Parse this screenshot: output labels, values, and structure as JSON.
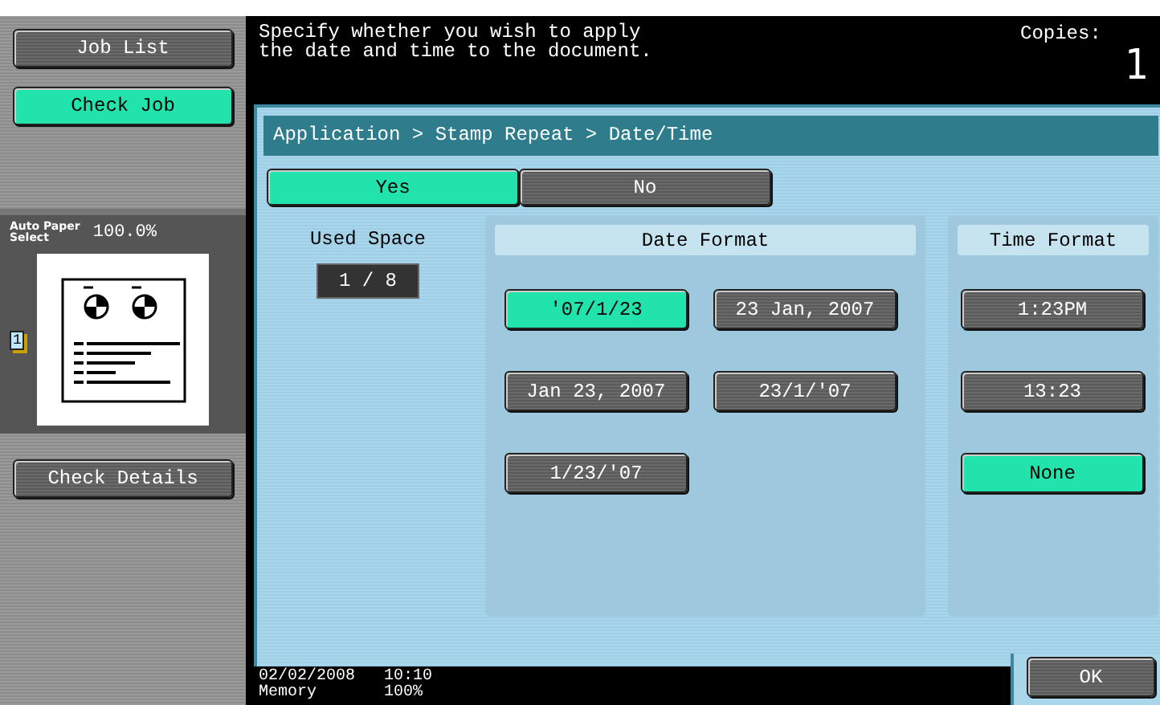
{
  "sidebar": {
    "buttons": [
      {
        "label": "Job List",
        "selected": false
      },
      {
        "label": "Check Job",
        "selected": true
      }
    ],
    "preview": {
      "paper_lines": [
        "Auto Paper",
        "Select"
      ],
      "zoom": "100.0%",
      "copies_badge": "1"
    },
    "details_button": "Check Details"
  },
  "header": {
    "message_lines": [
      "Specify whether you wish to apply",
      "the date and time to the document."
    ],
    "copies_label": "Copies:",
    "copies": "1"
  },
  "breadcrumb": "Application > Stamp Repeat > Date/Time",
  "toggle": [
    {
      "label": "Yes",
      "selected": true
    },
    {
      "label": "No",
      "selected": false
    }
  ],
  "used_space": {
    "label": "Used Space",
    "value": "1 / 8"
  },
  "date_format": {
    "title": "Date Format",
    "options": [
      {
        "label": "'07/1/23",
        "selected": true
      },
      {
        "label": "23 Jan, 2007",
        "selected": false
      },
      {
        "label": "Jan 23, 2007",
        "selected": false
      },
      {
        "label": "23/1/'07",
        "selected": false
      },
      {
        "label": "1/23/'07",
        "selected": false
      }
    ]
  },
  "time_format": {
    "title": "Time Format",
    "options": [
      {
        "label": "1:23PM",
        "selected": false
      },
      {
        "label": "13:23",
        "selected": false
      },
      {
        "label": "None",
        "selected": true
      }
    ]
  },
  "status_bar": {
    "date": "02/02/2008",
    "time": "10:10",
    "memory_label": "Memory",
    "memory": "100%"
  },
  "ok_button": "OK"
}
